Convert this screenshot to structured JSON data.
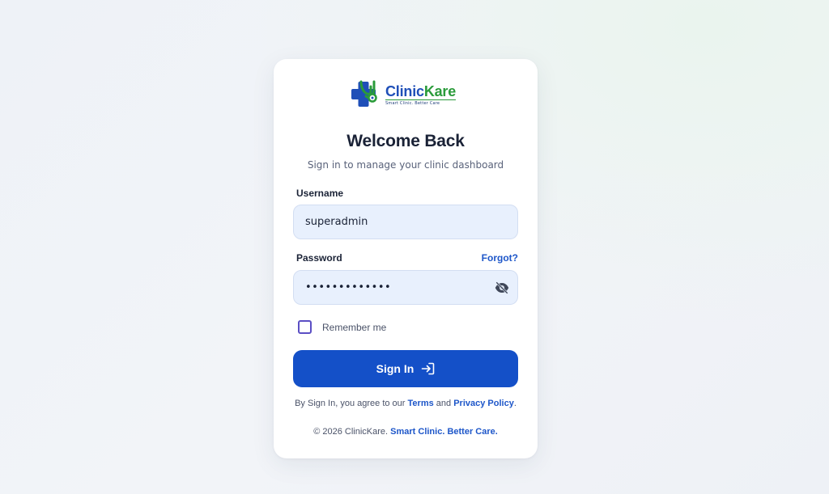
{
  "brand": {
    "name_part1": "Clinic",
    "name_part2": "Kare",
    "tagline": "Smart Clinic. Better Care",
    "primary_color": "#1f4fb8",
    "secondary_color": "#2a9b3a"
  },
  "header": {
    "title": "Welcome Back",
    "subtitle": "Sign in to manage your clinic dashboard"
  },
  "form": {
    "username_label": "Username",
    "username_value": "superadmin",
    "password_label": "Password",
    "password_value": "•••••••••••••",
    "forgot_label": "Forgot?",
    "remember_label": "Remember me",
    "remember_checked": false,
    "signin_label": "Sign In",
    "password_toggle_icon": "eye-off-icon",
    "signin_icon": "login-arrow-icon"
  },
  "legal": {
    "prefix": "By Sign In, you agree to our",
    "terms": "Terms",
    "and": "and",
    "privacy": "Privacy Policy",
    "suffix": "."
  },
  "footer": {
    "copyright": "© 2026 ClinicKare.",
    "slogan": "Smart Clinic. Better Care."
  },
  "colors": {
    "accent": "#1450c8",
    "link": "#1d56c9",
    "input_bg": "#e8f0fd",
    "checkbox_border": "#5b4fc4"
  }
}
